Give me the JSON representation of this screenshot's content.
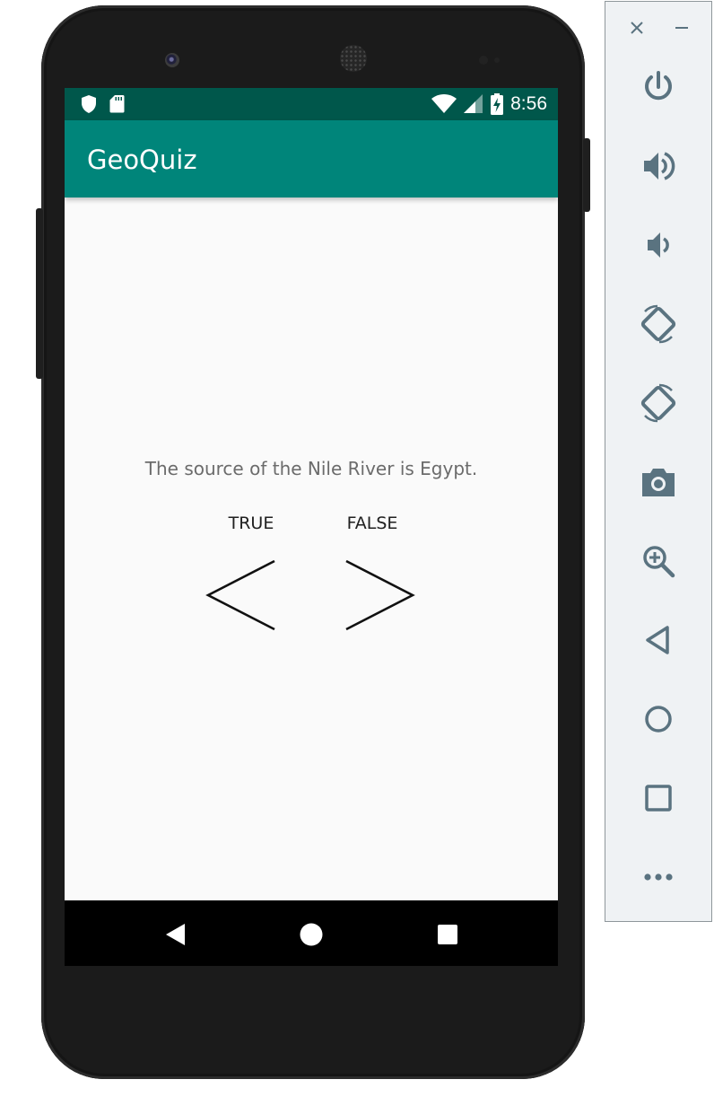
{
  "app": {
    "title": "GeoQuiz"
  },
  "status_bar": {
    "time": "8:56",
    "left_icons": [
      "shield-icon",
      "sd-card-icon"
    ],
    "right_icons": [
      "wifi-icon",
      "cell-signal-icon",
      "battery-charging-icon"
    ],
    "color": "#00574b"
  },
  "app_bar": {
    "color": "#00857a"
  },
  "quiz": {
    "question": "The source of the Nile River is Egypt.",
    "true_label": "TRUE",
    "false_label": "FALSE",
    "prev_icon": "chevron-left-icon",
    "next_icon": "chevron-right-icon"
  },
  "system_nav": [
    "back-icon",
    "home-icon",
    "recents-icon"
  ],
  "emulator_toolbar": {
    "window_controls": [
      "close-icon",
      "minimize-icon"
    ],
    "buttons": [
      "power-icon",
      "volume-up-icon",
      "volume-down-icon",
      "rotate-left-icon",
      "rotate-right-icon",
      "camera-icon",
      "zoom-icon",
      "back-icon",
      "home-icon",
      "overview-icon",
      "more-icon"
    ],
    "icon_color": "#5a7380"
  }
}
